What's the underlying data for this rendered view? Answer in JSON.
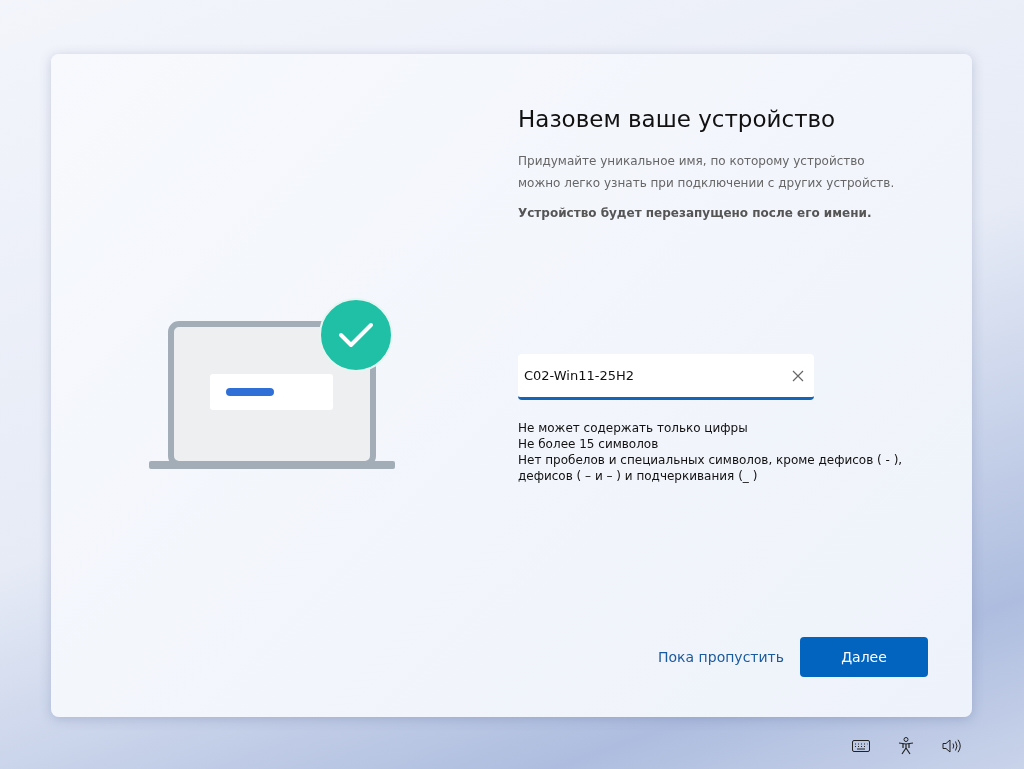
{
  "dialog": {
    "title": "Назовем ваше устройство",
    "description": "Придумайте уникальное имя, по которому устройство можно легко узнать при подключении с других устройств.",
    "note": "Устройство будет перезапущено после его имени.",
    "name_field": {
      "value": "C02-Win11-25H2",
      "focused": true
    },
    "rules": [
      "Не может содержать только цифры",
      "Не более 15 символов",
      "Нет пробелов и специальных символов, кроме дефисов ( - ), дефисов ( – и – ) и подчеркивания (_ )"
    ],
    "skip_link": "Пока пропустить",
    "next_button": "Далее"
  },
  "tray": [
    {
      "kind": "keyboard"
    },
    {
      "kind": "accessibility"
    },
    {
      "kind": "volume"
    }
  ]
}
